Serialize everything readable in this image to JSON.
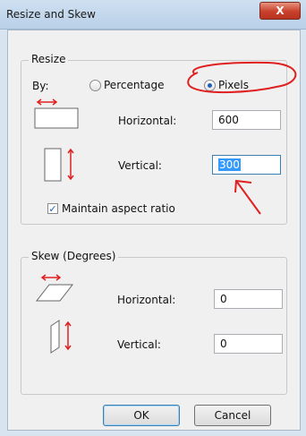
{
  "window": {
    "title": "Resize and Skew",
    "close_label": "X"
  },
  "resize": {
    "group_title": "Resize",
    "by_label": "By:",
    "option_percentage": "Percentage",
    "option_pixels": "Pixels",
    "selected": "Pixels",
    "horizontal_label": "Horizontal:",
    "horizontal_value": "600",
    "vertical_label": "Vertical:",
    "vertical_value_selected": "300",
    "maintain_label": "Maintain aspect ratio",
    "maintain_checked": true
  },
  "skew": {
    "group_title": "Skew (Degrees)",
    "horizontal_label": "Horizontal:",
    "horizontal_value": "0",
    "vertical_label": "Vertical:",
    "vertical_value": "0"
  },
  "buttons": {
    "ok": "OK",
    "cancel": "Cancel"
  },
  "colors": {
    "annotation": "#e02020",
    "accent": "#3399ff"
  }
}
